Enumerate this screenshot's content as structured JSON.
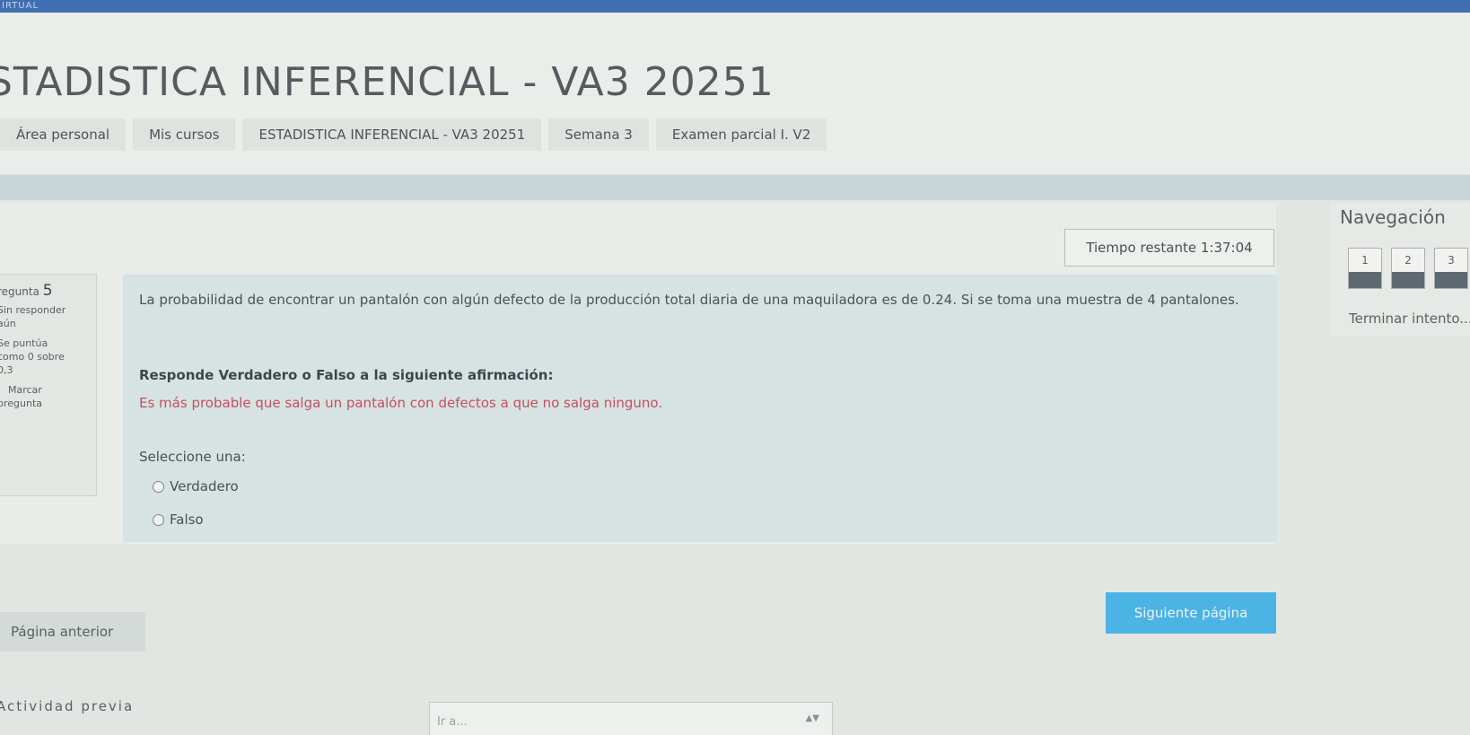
{
  "topbar": {
    "text": "IRTUAL"
  },
  "course_title": "STADISTICA INFERENCIAL - VA3 20251",
  "breadcrumb": [
    "Área personal",
    "Mis cursos",
    "ESTADISTICA INFERENCIAL - VA3 20251",
    "Semana 3",
    "Examen parcial I. V2"
  ],
  "timer": {
    "label": "Tiempo restante",
    "value": "1:37:04"
  },
  "question_info": {
    "label": "regunta",
    "number": "5",
    "status": "Sin responder",
    "status2": "aún",
    "grade_line1": "Se puntúa",
    "grade_line2": "como 0 sobre",
    "grade_line3": "0,3",
    "flag_line1": "Marcar",
    "flag_line2": "pregunta"
  },
  "question": {
    "text": "La probabilidad de encontrar un pantalón con algún defecto de la producción total diaria de una maquiladora es de 0.24. Si se toma una muestra de 4 pantalones.",
    "instruction": "Responde Verdadero o Falso a la siguiente afirmación:",
    "statement": "Es más probable que salga un pantalón con defectos a que no salga ninguno.",
    "select_label": "Seleccione una:",
    "options": [
      "Verdadero",
      "Falso"
    ]
  },
  "navigation": {
    "title": "Navegación",
    "pages": [
      "1",
      "2",
      "3"
    ],
    "finish_label": "Terminar intento..."
  },
  "buttons": {
    "prev": "Página anterior",
    "next": "Siguiente página"
  },
  "footer": {
    "prev_activity": "Actividad previa",
    "jump_placeholder": "Ir a..."
  }
}
